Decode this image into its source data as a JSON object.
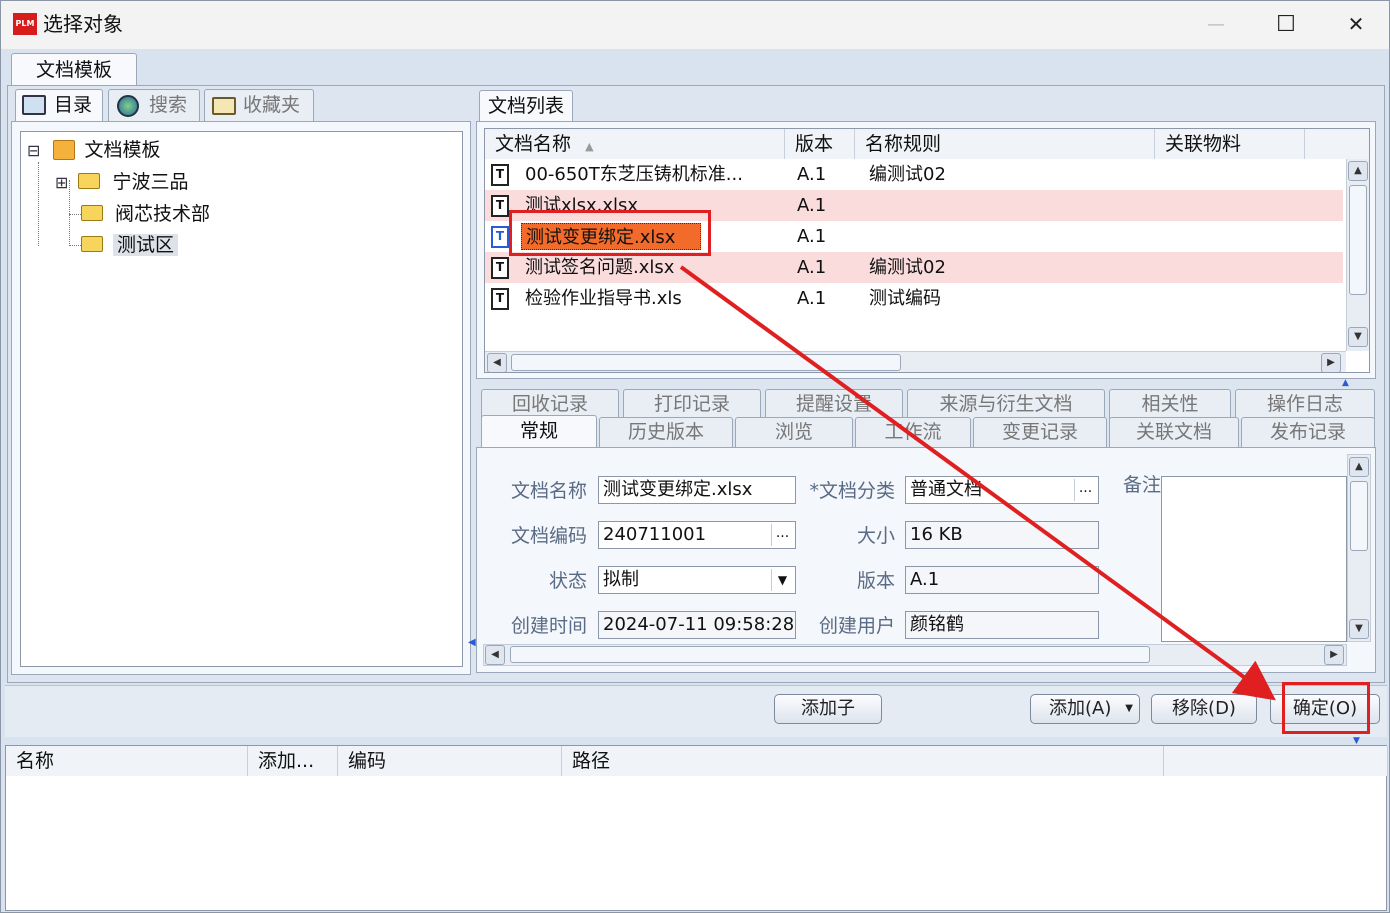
{
  "window": {
    "title": "选择对象",
    "logo": "PLM",
    "minimize_glyph": "—",
    "maximize_glyph": "☐",
    "close_glyph": "✕"
  },
  "outer_tab": "文档模板",
  "left_tabs": [
    "目录",
    "搜索",
    "收藏夹"
  ],
  "tree": {
    "root": "文档模板",
    "children": [
      "宁波三品",
      "阀芯技术部",
      "测试区"
    ],
    "expander_collapsed": "⊞",
    "expander_expanded": "⊟"
  },
  "doc_list": {
    "tab": "文档列表",
    "columns": [
      "文档名称",
      "版本",
      "名称规则",
      "关联物料"
    ],
    "sort_indicator": "▲",
    "rows": [
      {
        "name": "00-650T东芝压铸机标准...",
        "version": "A.1",
        "rule": "编测试02",
        "material": ""
      },
      {
        "name": "测试xlsx.xlsx",
        "version": "A.1",
        "rule": "",
        "material": ""
      },
      {
        "name": "测试变更绑定.xlsx",
        "version": "A.1",
        "rule": "",
        "material": ""
      },
      {
        "name": "测试签名问题.xlsx",
        "version": "A.1",
        "rule": "编测试02",
        "material": ""
      },
      {
        "name": "检验作业指导书.xls",
        "version": "A.1",
        "rule": "测试编码",
        "material": ""
      }
    ],
    "doc_icon_glyph": "T"
  },
  "detail_tabs_row1": [
    "回收记录",
    "打印记录",
    "提醒设置",
    "来源与衍生文档",
    "相关性",
    "操作日志"
  ],
  "detail_tabs_row2": [
    "常规",
    "历史版本",
    "浏览",
    "工作流",
    "变更记录",
    "关联文档",
    "发布记录"
  ],
  "form": {
    "doc_name_label": "文档名称",
    "doc_name_value": "测试变更绑定.xlsx",
    "doc_class_label": "*文档分类",
    "doc_class_value": "普通文档",
    "remark_label": "备注",
    "doc_code_label": "文档编码",
    "doc_code_value": "240711001",
    "size_label": "大小",
    "size_value": "16 KB",
    "status_label": "状态",
    "status_value": "拟制",
    "version_label": "版本",
    "version_value": "A.1",
    "created_time_label": "创建时间",
    "created_time_value": "2024-07-11 09:58:28",
    "created_user_label": "创建用户",
    "created_user_value": "颜铭鹤",
    "ellipsis": "...",
    "dropdown_glyph": "▼"
  },
  "buttons": {
    "add_child": "添加子",
    "add": "添加(A)",
    "remove": "移除(D)",
    "ok": "确定(O)"
  },
  "bottom_table": {
    "columns": [
      "名称",
      "添加...",
      "编码",
      "路径"
    ]
  },
  "colors": {
    "accent_red": "#e02020",
    "selection_orange": "#f26b2a",
    "row_pink": "#fbdcdc"
  }
}
